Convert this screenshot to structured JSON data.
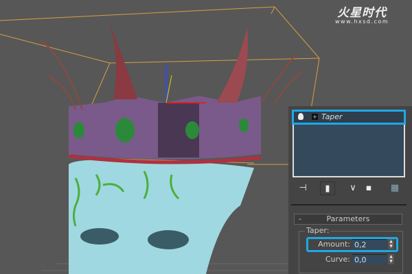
{
  "watermark": {
    "brand": "火星时代",
    "url": "www.hxsd.com"
  },
  "modifier_stack": {
    "items": [
      {
        "label": "Taper",
        "selected": true
      }
    ]
  },
  "toolbar": {
    "icons": [
      "pin-stack-icon",
      "show-end-result-icon",
      "make-unique-icon",
      "remove-modifier-icon",
      "configure-modifier-sets-icon"
    ]
  },
  "parameters": {
    "rollout_title": "Parameters",
    "collapse_symbol": "-",
    "group_label": "Taper:",
    "amount_label": "Amount:",
    "amount_value": "0,2",
    "curve_label": "Curve:",
    "curve_value": "0,0"
  },
  "colors": {
    "highlight": "#1ea8e6",
    "bounding_box": "#d9a040",
    "crown": "#7a5a8a",
    "head": "#9fd8e0"
  }
}
